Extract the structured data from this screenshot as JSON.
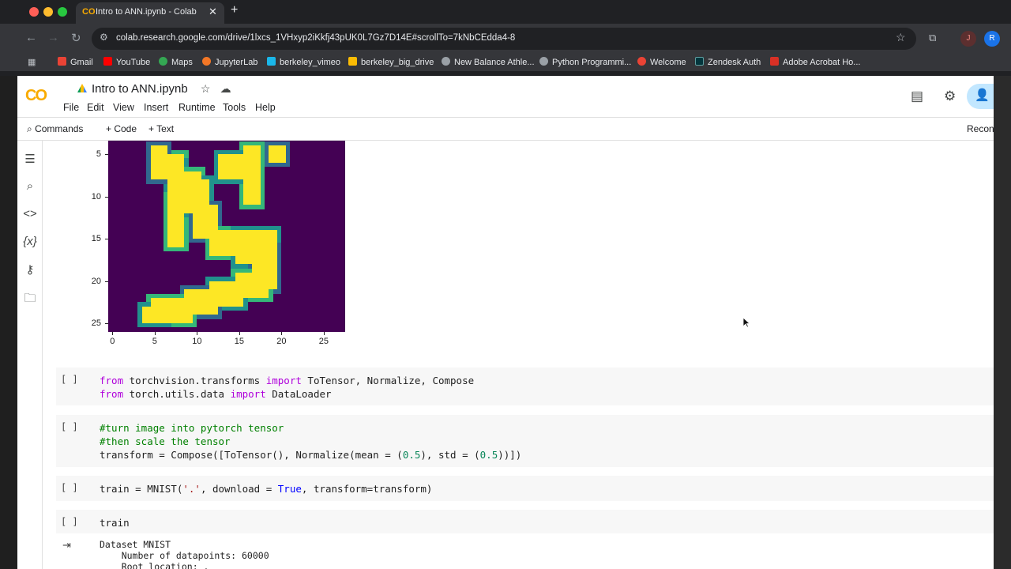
{
  "browser": {
    "tab_title": "Intro to ANN.ipynb - Colab",
    "tab_logo": "CO",
    "url": "colab.research.google.com/drive/1lxcs_1VHxyp2iKkfj43pUK0L7Gz7D14E#scrollTo=7kNbCEdda4-8",
    "profile_initials": [
      "J",
      "R"
    ],
    "bookmarks": [
      {
        "label": "Gmail",
        "color": "#ea4335"
      },
      {
        "label": "YouTube",
        "color": "#ff0000"
      },
      {
        "label": "Maps",
        "color": "#34a853"
      },
      {
        "label": "JupyterLab",
        "color": "#f37726"
      },
      {
        "label": "berkeley_vimeo",
        "color": "#1ab7ea"
      },
      {
        "label": "berkeley_big_drive",
        "color": "#fbbc04"
      },
      {
        "label": "New Balance Athle...",
        "color": "#9aa0a6"
      },
      {
        "label": "Python Programmi...",
        "color": "#9aa0a6"
      },
      {
        "label": "Welcome",
        "color": "#ea4335"
      },
      {
        "label": "Zendesk Auth",
        "color": "#03363d"
      },
      {
        "label": "Adobe Acrobat Ho...",
        "color": "#d93025"
      }
    ]
  },
  "colab": {
    "notebook_title": "Intro to ANN.ipynb",
    "menu": [
      "File",
      "Edit",
      "View",
      "Insert",
      "Runtime",
      "Tools",
      "Help"
    ],
    "toolbar": {
      "commands": "Commands",
      "code": "Code",
      "text": "Text",
      "reconnect": "Reconn"
    }
  },
  "figure": {
    "y_ticks": [
      "5",
      "10",
      "15",
      "20",
      "25"
    ],
    "x_ticks": [
      "0",
      "5",
      "10",
      "15",
      "20",
      "25"
    ]
  },
  "cells": [
    {
      "run": "[ ]"
    },
    {
      "run": "[ ]"
    },
    {
      "run": "[ ]"
    },
    {
      "run": "[ ]",
      "code": "train"
    }
  ],
  "code_tokens": {
    "from": "from",
    "import": "import",
    "mod1": " torchvision.transforms ",
    "names1": " ToTensor, Normalize, Compose",
    "mod2": " torch.utils.data ",
    "names2": " DataLoader",
    "comment1": "#turn image into pytorch tensor",
    "comment2": "#then scale the tensor",
    "transform_a": "transform = Compose([ToTensor(), Normalize(mean = (",
    "num1": "0.5",
    "transform_b": "), std = (",
    "num2": "0.5",
    "transform_c": "))])",
    "train_a": "train = MNIST(",
    "str1": "'.'",
    "train_b": ", download = ",
    "true": "True",
    "train_c": ", transform=transform)"
  },
  "output": {
    "lines": [
      "Dataset MNIST",
      "    Number of datapoints: 60000",
      "    Root location: ."
    ]
  },
  "colors": {
    "accent": "#f9ab00",
    "viridis_bg": "#440154",
    "viridis_fg": "#fde725"
  }
}
